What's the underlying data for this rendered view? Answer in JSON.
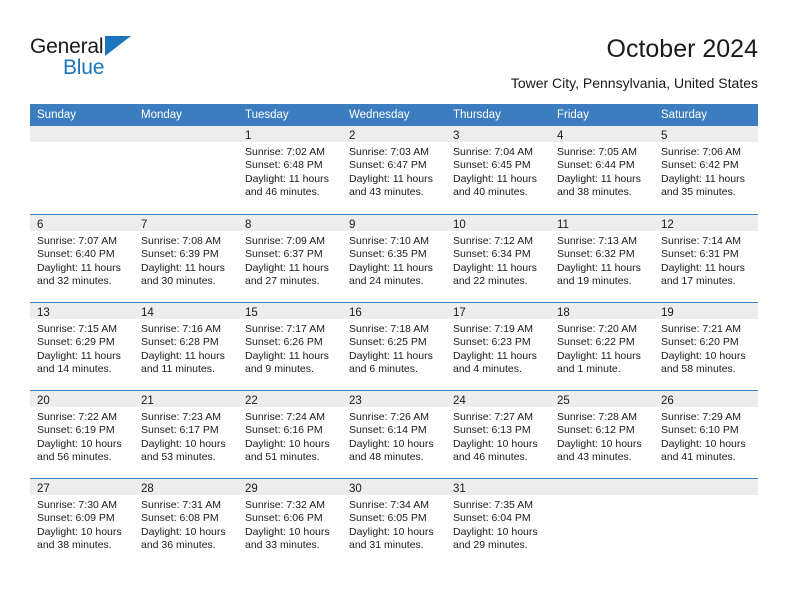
{
  "brand": {
    "name_primary": "General",
    "name_secondary": "Blue"
  },
  "header": {
    "title": "October 2024",
    "location": "Tower City, Pennsylvania, United States"
  },
  "calendar": {
    "day_headers": [
      "Sunday",
      "Monday",
      "Tuesday",
      "Wednesday",
      "Thursday",
      "Friday",
      "Saturday"
    ],
    "colors": {
      "header_blue": "#3c7dbf",
      "day_band_gray": "#ededed",
      "brand_blue": "#1b75bb"
    },
    "weeks": [
      [
        {
          "day": "",
          "sunrise": "",
          "sunset": "",
          "daylight": ""
        },
        {
          "day": "",
          "sunrise": "",
          "sunset": "",
          "daylight": ""
        },
        {
          "day": "1",
          "sunrise": "Sunrise: 7:02 AM",
          "sunset": "Sunset: 6:48 PM",
          "daylight": "Daylight: 11 hours and 46 minutes."
        },
        {
          "day": "2",
          "sunrise": "Sunrise: 7:03 AM",
          "sunset": "Sunset: 6:47 PM",
          "daylight": "Daylight: 11 hours and 43 minutes."
        },
        {
          "day": "3",
          "sunrise": "Sunrise: 7:04 AM",
          "sunset": "Sunset: 6:45 PM",
          "daylight": "Daylight: 11 hours and 40 minutes."
        },
        {
          "day": "4",
          "sunrise": "Sunrise: 7:05 AM",
          "sunset": "Sunset: 6:44 PM",
          "daylight": "Daylight: 11 hours and 38 minutes."
        },
        {
          "day": "5",
          "sunrise": "Sunrise: 7:06 AM",
          "sunset": "Sunset: 6:42 PM",
          "daylight": "Daylight: 11 hours and 35 minutes."
        }
      ],
      [
        {
          "day": "6",
          "sunrise": "Sunrise: 7:07 AM",
          "sunset": "Sunset: 6:40 PM",
          "daylight": "Daylight: 11 hours and 32 minutes."
        },
        {
          "day": "7",
          "sunrise": "Sunrise: 7:08 AM",
          "sunset": "Sunset: 6:39 PM",
          "daylight": "Daylight: 11 hours and 30 minutes."
        },
        {
          "day": "8",
          "sunrise": "Sunrise: 7:09 AM",
          "sunset": "Sunset: 6:37 PM",
          "daylight": "Daylight: 11 hours and 27 minutes."
        },
        {
          "day": "9",
          "sunrise": "Sunrise: 7:10 AM",
          "sunset": "Sunset: 6:35 PM",
          "daylight": "Daylight: 11 hours and 24 minutes."
        },
        {
          "day": "10",
          "sunrise": "Sunrise: 7:12 AM",
          "sunset": "Sunset: 6:34 PM",
          "daylight": "Daylight: 11 hours and 22 minutes."
        },
        {
          "day": "11",
          "sunrise": "Sunrise: 7:13 AM",
          "sunset": "Sunset: 6:32 PM",
          "daylight": "Daylight: 11 hours and 19 minutes."
        },
        {
          "day": "12",
          "sunrise": "Sunrise: 7:14 AM",
          "sunset": "Sunset: 6:31 PM",
          "daylight": "Daylight: 11 hours and 17 minutes."
        }
      ],
      [
        {
          "day": "13",
          "sunrise": "Sunrise: 7:15 AM",
          "sunset": "Sunset: 6:29 PM",
          "daylight": "Daylight: 11 hours and 14 minutes."
        },
        {
          "day": "14",
          "sunrise": "Sunrise: 7:16 AM",
          "sunset": "Sunset: 6:28 PM",
          "daylight": "Daylight: 11 hours and 11 minutes."
        },
        {
          "day": "15",
          "sunrise": "Sunrise: 7:17 AM",
          "sunset": "Sunset: 6:26 PM",
          "daylight": "Daylight: 11 hours and 9 minutes."
        },
        {
          "day": "16",
          "sunrise": "Sunrise: 7:18 AM",
          "sunset": "Sunset: 6:25 PM",
          "daylight": "Daylight: 11 hours and 6 minutes."
        },
        {
          "day": "17",
          "sunrise": "Sunrise: 7:19 AM",
          "sunset": "Sunset: 6:23 PM",
          "daylight": "Daylight: 11 hours and 4 minutes."
        },
        {
          "day": "18",
          "sunrise": "Sunrise: 7:20 AM",
          "sunset": "Sunset: 6:22 PM",
          "daylight": "Daylight: 11 hours and 1 minute."
        },
        {
          "day": "19",
          "sunrise": "Sunrise: 7:21 AM",
          "sunset": "Sunset: 6:20 PM",
          "daylight": "Daylight: 10 hours and 58 minutes."
        }
      ],
      [
        {
          "day": "20",
          "sunrise": "Sunrise: 7:22 AM",
          "sunset": "Sunset: 6:19 PM",
          "daylight": "Daylight: 10 hours and 56 minutes."
        },
        {
          "day": "21",
          "sunrise": "Sunrise: 7:23 AM",
          "sunset": "Sunset: 6:17 PM",
          "daylight": "Daylight: 10 hours and 53 minutes."
        },
        {
          "day": "22",
          "sunrise": "Sunrise: 7:24 AM",
          "sunset": "Sunset: 6:16 PM",
          "daylight": "Daylight: 10 hours and 51 minutes."
        },
        {
          "day": "23",
          "sunrise": "Sunrise: 7:26 AM",
          "sunset": "Sunset: 6:14 PM",
          "daylight": "Daylight: 10 hours and 48 minutes."
        },
        {
          "day": "24",
          "sunrise": "Sunrise: 7:27 AM",
          "sunset": "Sunset: 6:13 PM",
          "daylight": "Daylight: 10 hours and 46 minutes."
        },
        {
          "day": "25",
          "sunrise": "Sunrise: 7:28 AM",
          "sunset": "Sunset: 6:12 PM",
          "daylight": "Daylight: 10 hours and 43 minutes."
        },
        {
          "day": "26",
          "sunrise": "Sunrise: 7:29 AM",
          "sunset": "Sunset: 6:10 PM",
          "daylight": "Daylight: 10 hours and 41 minutes."
        }
      ],
      [
        {
          "day": "27",
          "sunrise": "Sunrise: 7:30 AM",
          "sunset": "Sunset: 6:09 PM",
          "daylight": "Daylight: 10 hours and 38 minutes."
        },
        {
          "day": "28",
          "sunrise": "Sunrise: 7:31 AM",
          "sunset": "Sunset: 6:08 PM",
          "daylight": "Daylight: 10 hours and 36 minutes."
        },
        {
          "day": "29",
          "sunrise": "Sunrise: 7:32 AM",
          "sunset": "Sunset: 6:06 PM",
          "daylight": "Daylight: 10 hours and 33 minutes."
        },
        {
          "day": "30",
          "sunrise": "Sunrise: 7:34 AM",
          "sunset": "Sunset: 6:05 PM",
          "daylight": "Daylight: 10 hours and 31 minutes."
        },
        {
          "day": "31",
          "sunrise": "Sunrise: 7:35 AM",
          "sunset": "Sunset: 6:04 PM",
          "daylight": "Daylight: 10 hours and 29 minutes."
        },
        {
          "day": "",
          "sunrise": "",
          "sunset": "",
          "daylight": ""
        },
        {
          "day": "",
          "sunrise": "",
          "sunset": "",
          "daylight": ""
        }
      ]
    ]
  }
}
